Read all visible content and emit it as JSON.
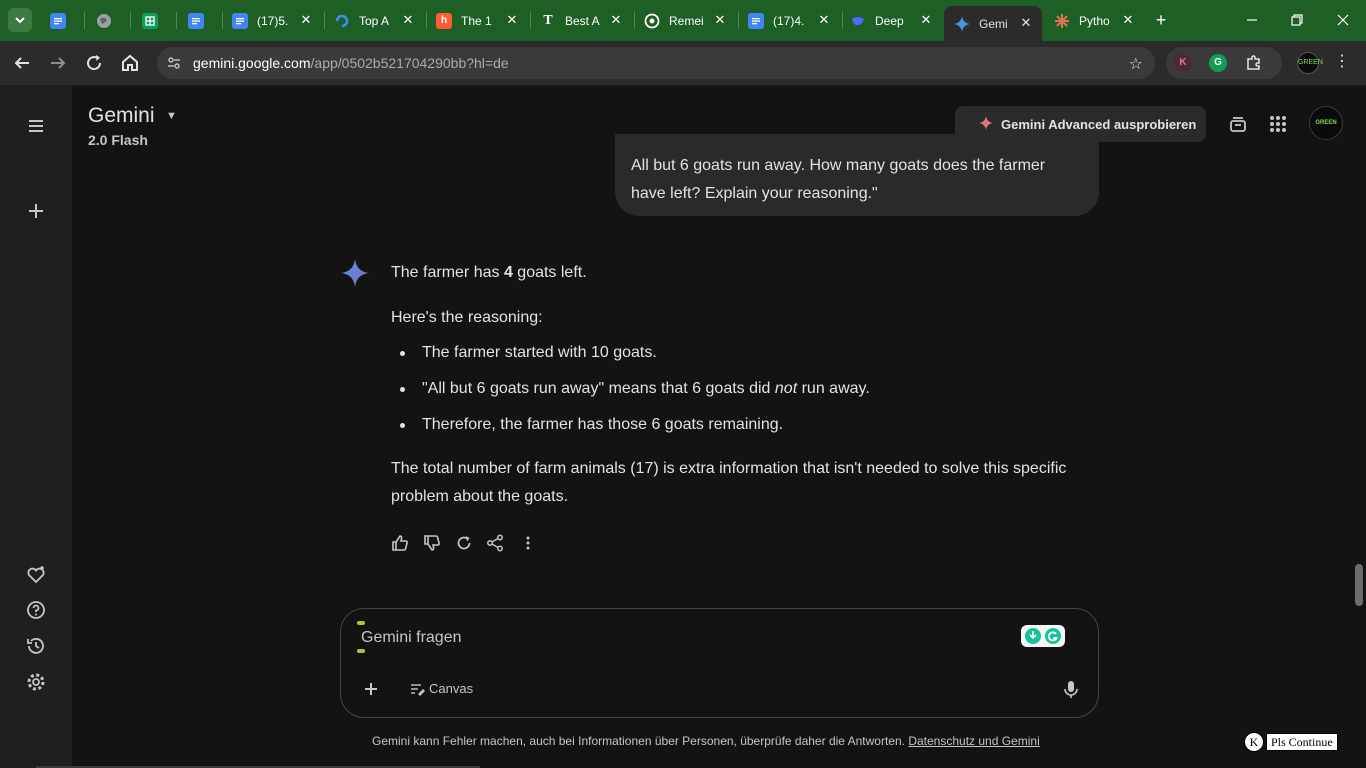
{
  "browser": {
    "tabs": [
      {
        "title": "",
        "icon": "google-docs-icon",
        "color": "#4285f4"
      },
      {
        "title": "",
        "icon": "globe-icon",
        "color": "#9aa0a6"
      },
      {
        "title": "",
        "icon": "google-sheets-icon",
        "color": "#0f9d58"
      },
      {
        "title": "",
        "icon": "google-docs-icon",
        "color": "#4285f4"
      },
      {
        "title": "(17)5.",
        "icon": "google-docs-icon",
        "color": "#4285f4"
      },
      {
        "title": "Top A",
        "icon": "refresh-blue-icon",
        "color": "#3f8cff"
      },
      {
        "title": "The 1",
        "icon": "hubspot-icon",
        "color": "#ff5c35"
      },
      {
        "title": "Best A",
        "icon": "t-logo-icon",
        "color": "#e3e3e3"
      },
      {
        "title": "Remei",
        "icon": "openai-icon",
        "color": "#e3e3e3"
      },
      {
        "title": "(17)4.",
        "icon": "google-docs-icon",
        "color": "#4285f4"
      },
      {
        "title": "Deep",
        "icon": "deepseek-icon",
        "color": "#4d6bfe"
      },
      {
        "title": "Gemi",
        "icon": "gemini-sparkle-icon",
        "color": "#4796e3",
        "active": true
      },
      {
        "title": "Pytho",
        "icon": "claude-icon",
        "color": "#d97757"
      }
    ],
    "url_host": "gemini.google.com",
    "url_path": "/app/0502b521704290bb?hl=de",
    "ext_k": "K",
    "profile_text": "GREEN"
  },
  "header": {
    "app_title": "Gemini",
    "model": "2.0 Flash",
    "advanced_button": "Gemini Advanced ausprobieren",
    "avatar_text": "GREEN"
  },
  "chat": {
    "user_line_1": "All but 6 goats run away. How many goats does the farmer",
    "user_line_2": "have left? Explain your reasoning.\"",
    "answer_pre": "The farmer has ",
    "answer_bold": "4",
    "answer_post": " goats left.",
    "reasoning_heading": "Here's the reasoning:",
    "bullet_1": "The farmer started with 10 goats.",
    "bullet_2_pre": "\"All but 6 goats run away\" means that 6 goats did ",
    "bullet_2_em": "not",
    "bullet_2_post": " run away.",
    "bullet_3": "Therefore, the farmer has those 6 goats remaining.",
    "conclusion_line_1": "The total number of farm animals (17) is extra information that isn't needed to solve this specific",
    "conclusion_line_2": "problem about the goats."
  },
  "input": {
    "placeholder": "Gemini fragen",
    "canvas_label": "Canvas"
  },
  "footer": {
    "disclaimer": "Gemini kann Fehler machen, auch bei Informationen über Personen, überprüfe daher die Antworten. ",
    "privacy_link": "Datenschutz und Gemini",
    "pls_k": "K",
    "pls_continue": "Pls Continue"
  }
}
